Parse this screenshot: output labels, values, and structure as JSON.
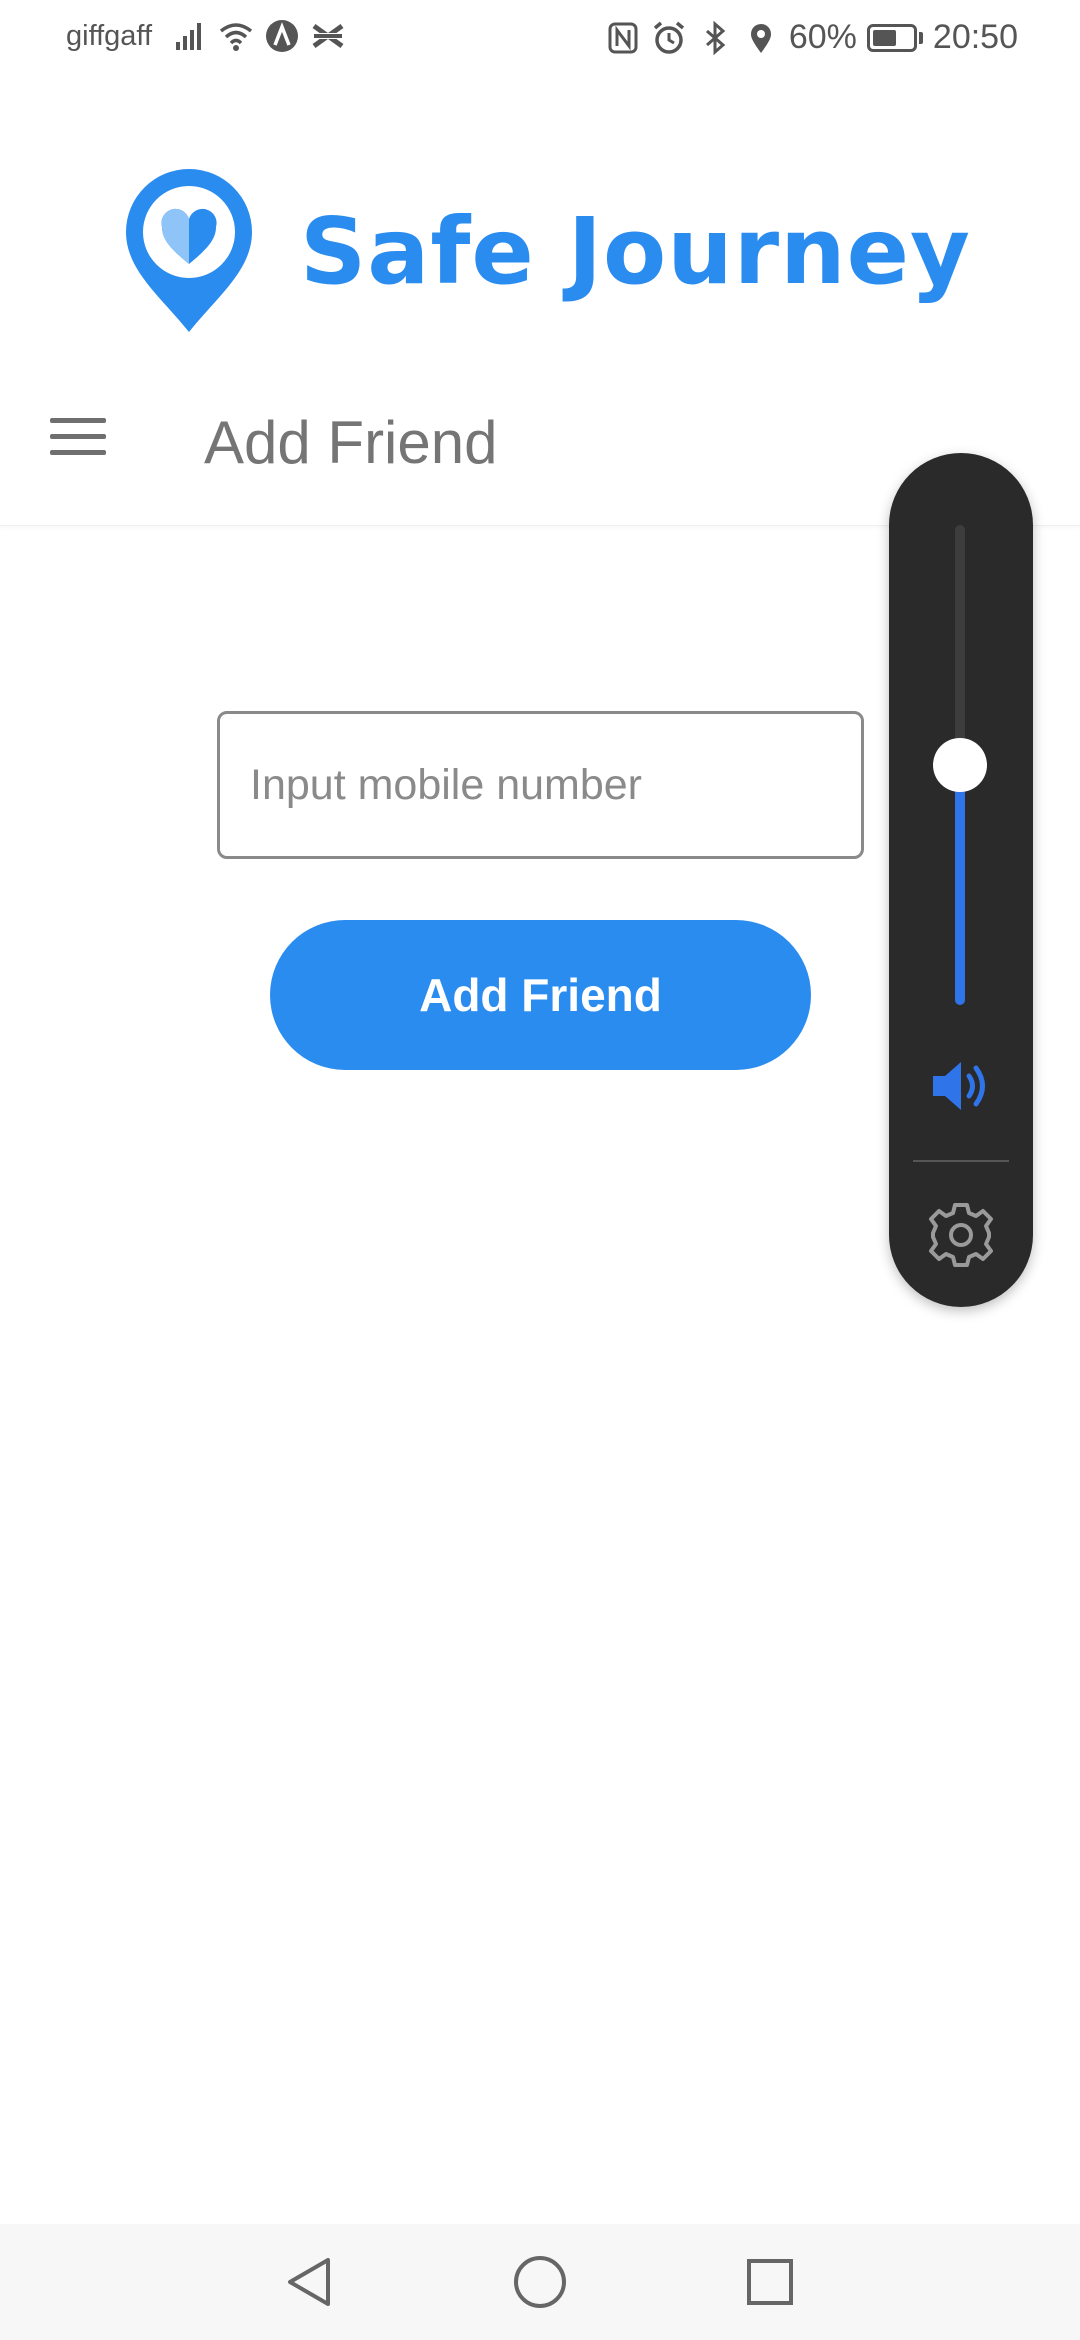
{
  "status_bar": {
    "carrier": "giffgaff",
    "battery_percent": "60%",
    "battery_level": 0.6,
    "time": "20:50",
    "icons": [
      "signal-icon",
      "wifi-icon",
      "a-badge-icon",
      "halifax-icon",
      "nfc-icon",
      "alarm-icon",
      "bluetooth-icon",
      "location-icon",
      "battery-icon"
    ]
  },
  "logo": {
    "text": "Safe Journey",
    "color": "#2b8cf0"
  },
  "header": {
    "title": "Add Friend"
  },
  "form": {
    "mobile_placeholder": "Input mobile number",
    "mobile_value": "",
    "add_button_label": "Add Friend"
  },
  "volume": {
    "level": 0.5,
    "accent_color": "#2f74e8"
  },
  "nav": {
    "icons": [
      "back-icon",
      "home-icon",
      "recent-apps-icon"
    ]
  }
}
